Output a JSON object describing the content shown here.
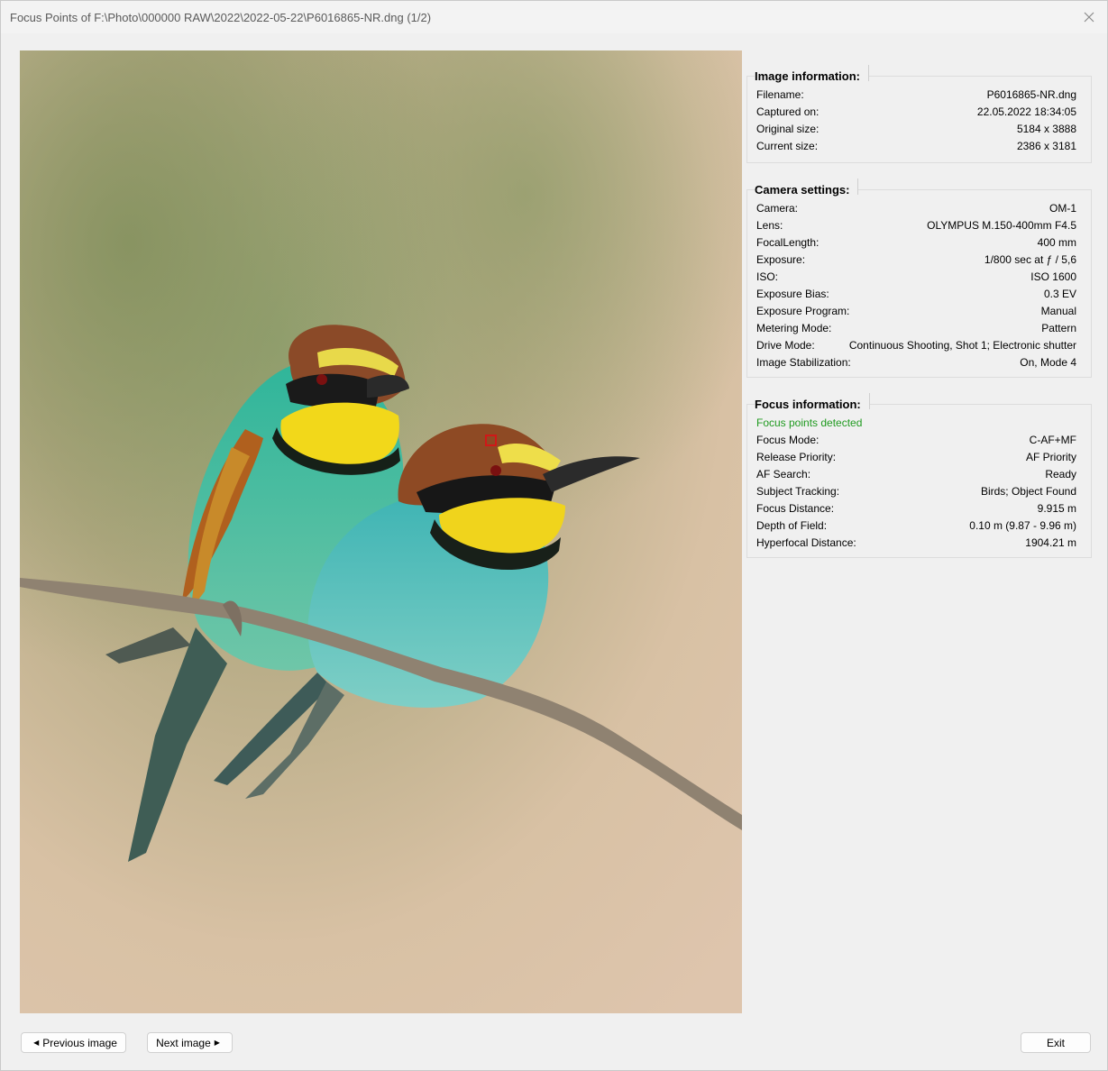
{
  "window": {
    "title": "Focus Points of F:\\Photo\\000000 RAW\\2022\\2022-05-22\\P6016865-NR.dng (1/2)",
    "close_icon": "close-icon"
  },
  "image_info": {
    "header": "Image information:",
    "rows": [
      {
        "label": "Filename:",
        "value": "P6016865-NR.dng"
      },
      {
        "label": "Captured on:",
        "value": "22.05.2022 18:34:05"
      },
      {
        "label": "Original size:",
        "value": "5184 x 3888"
      },
      {
        "label": "Current size:",
        "value": "2386 x 3181"
      }
    ]
  },
  "camera_settings": {
    "header": "Camera settings:",
    "rows": [
      {
        "label": "Camera:",
        "value": "OM-1"
      },
      {
        "label": "Lens:",
        "value": "OLYMPUS M.150-400mm F4.5"
      },
      {
        "label": "FocalLength:",
        "value": "400 mm"
      },
      {
        "label": "Exposure:",
        "value": "1/800 sec at ƒ / 5,6"
      },
      {
        "label": "ISO:",
        "value": "ISO 1600"
      },
      {
        "label": "Exposure Bias:",
        "value": "0.3 EV"
      },
      {
        "label": "Exposure Program:",
        "value": "Manual"
      },
      {
        "label": "Metering Mode:",
        "value": "Pattern"
      },
      {
        "label": "Drive Mode:",
        "value": "Continuous Shooting, Shot 1; Electronic shutter"
      },
      {
        "label": "Image Stabilization:",
        "value": "On, Mode 4"
      }
    ]
  },
  "focus_info": {
    "header": "Focus information:",
    "status": "Focus points detected",
    "status_color": "#1f9a1f",
    "rows": [
      {
        "label": "Focus Mode:",
        "value": "C-AF+MF"
      },
      {
        "label": "Release Priority:",
        "value": "AF Priority"
      },
      {
        "label": "AF Search:",
        "value": "Ready"
      },
      {
        "label": "Subject Tracking:",
        "value": "Birds; Object Found"
      },
      {
        "label": "Focus Distance:",
        "value": "9.915 m"
      },
      {
        "label": "Depth of Field:",
        "value": "0.10 m (9.87 - 9.96 m)"
      },
      {
        "label": "Hyperfocal Distance:",
        "value": "1904.21 m"
      }
    ]
  },
  "buttons": {
    "previous": "Previous image",
    "next": "Next image",
    "exit": "Exit"
  },
  "colors": {
    "focus_point": "#d01818"
  }
}
